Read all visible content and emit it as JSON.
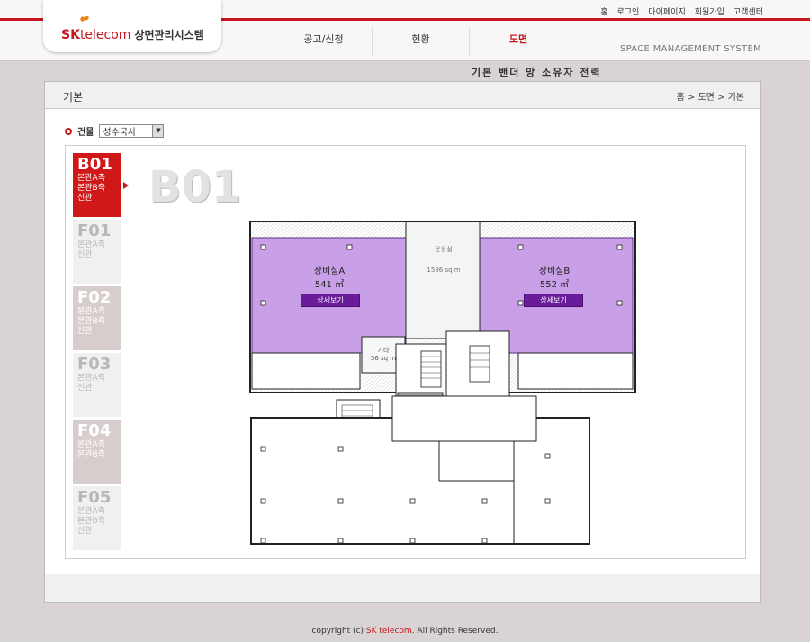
{
  "header": {
    "logo_sk": "SK",
    "logo_telecom": "telecom",
    "logo_system": "상면관리시스템",
    "util_links": [
      "홈",
      "로그인",
      "마이페이지",
      "회원가입",
      "고객센터"
    ],
    "gnb": [
      {
        "label": "공고/신청",
        "active": false
      },
      {
        "label": "현황",
        "active": false
      },
      {
        "label": "도면",
        "active": true
      }
    ],
    "subtitle": "SPACE MANAGEMENT SYSTEM",
    "subnav": "기본 밴더 망 소유자 전력",
    "accent_color": "#c4161c"
  },
  "page": {
    "title": "기본",
    "breadcrumb": "홈 > 도면 > 기본"
  },
  "building": {
    "label": "건물",
    "selected": "성수국사"
  },
  "floors": [
    {
      "code": "B01",
      "desc": [
        "본관A측",
        "본관B측",
        "신관"
      ],
      "state": "active"
    },
    {
      "code": "F01",
      "desc": [
        "본관A측",
        "신관"
      ],
      "state": "light"
    },
    {
      "code": "F02",
      "desc": [
        "본관A측",
        "본관B측",
        "신관"
      ],
      "state": "muted"
    },
    {
      "code": "F03",
      "desc": [
        "본관A측",
        "신관"
      ],
      "state": "light"
    },
    {
      "code": "F04",
      "desc": [
        "본관A측",
        "본관B측"
      ],
      "state": "muted"
    },
    {
      "code": "F05",
      "desc": [
        "본관A측",
        "본관B측",
        "신관"
      ],
      "state": "light"
    }
  ],
  "current_floor": "B01",
  "rooms": {
    "room_a": {
      "name": "장비실A",
      "area": "541 ㎡",
      "button": "상세보기"
    },
    "room_b": {
      "name": "장비실B",
      "area": "552 ㎡",
      "button": "상세보기"
    },
    "center": {
      "name": "운용실",
      "area": "1586 sq m"
    },
    "small": {
      "name": "기타",
      "area": "56 sq m"
    },
    "room_color": "#c9a0e8"
  },
  "footer": {
    "prefix": "copyright (c) ",
    "brand": "SK telecom",
    "suffix": ". All Rights Reserved."
  }
}
